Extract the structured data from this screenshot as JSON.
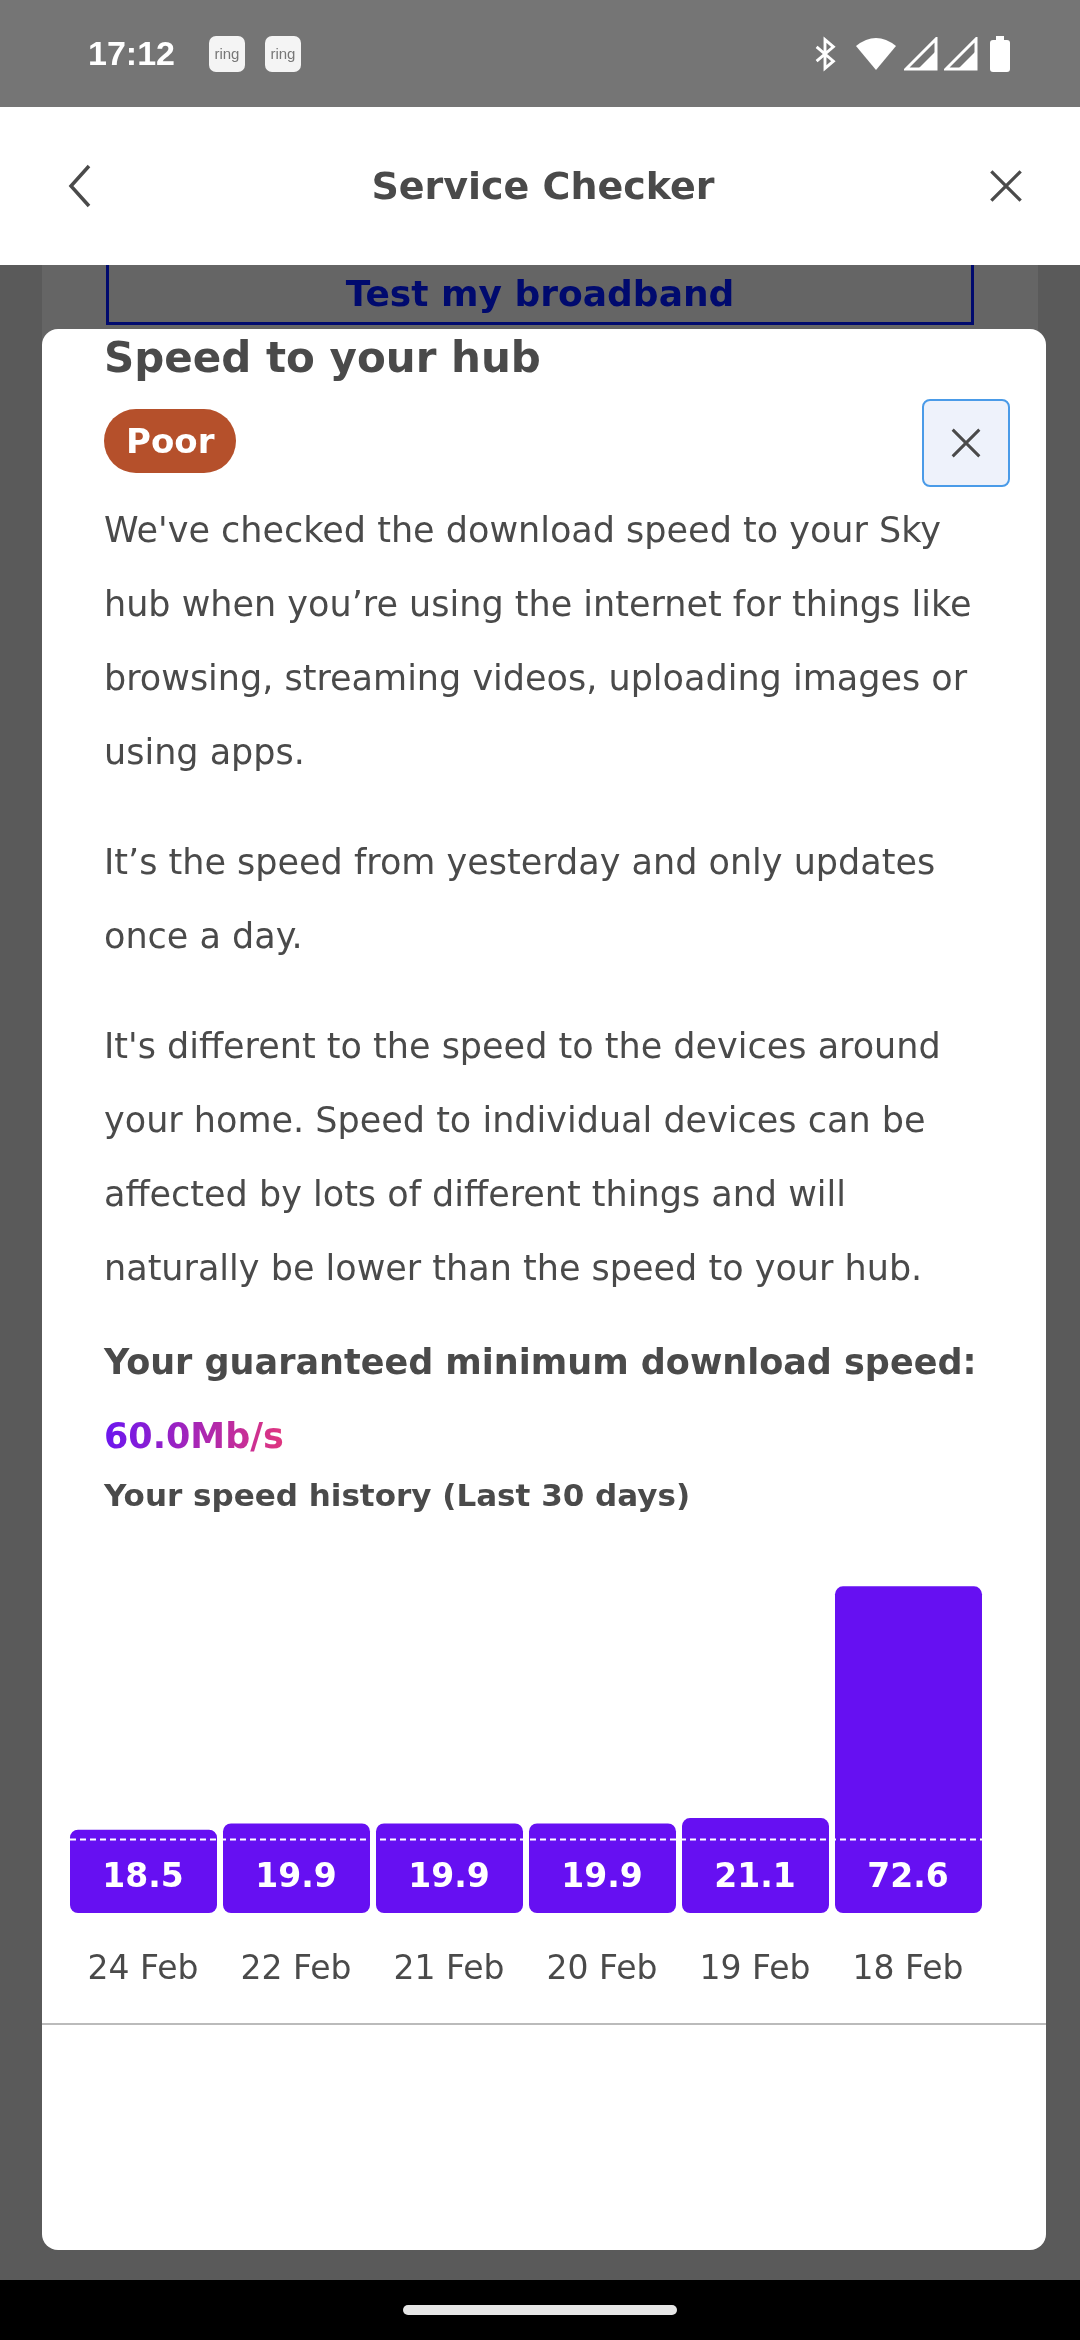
{
  "status_bar": {
    "time": "17:12",
    "notification_icons": [
      "ring",
      "ring"
    ]
  },
  "header": {
    "title": "Service Checker"
  },
  "background": {
    "button": "Test my broadband"
  },
  "modal": {
    "title": "Speed to your hub",
    "status_badge": "Poor",
    "paragraphs": [
      "We've checked the download speed to your Sky hub when you’re using the internet for things like browsing, streaming videos, uploading images or using apps.",
      "It’s the speed from yesterday and only updates once a day.",
      "It's different to the speed to the devices around your home. Speed to individual devices can be affected by lots of different things and will naturally be lower than the speed to your hub."
    ],
    "guaranteed_label": "Your guaranteed minimum download speed:",
    "guaranteed_value": "60.0Mb/s",
    "history_title": "Your speed history (Last 30 days)",
    "chart_data": {
      "type": "bar",
      "categories": [
        "24 Feb",
        "22 Feb",
        "21 Feb",
        "20 Feb",
        "19 Feb",
        "18 Feb"
      ],
      "series": [
        {
          "color": "#6610f2",
          "values": [
            18.5,
            19.9,
            19.9,
            19.9,
            21.1,
            72.6
          ]
        }
      ],
      "data_labels": true
    }
  }
}
